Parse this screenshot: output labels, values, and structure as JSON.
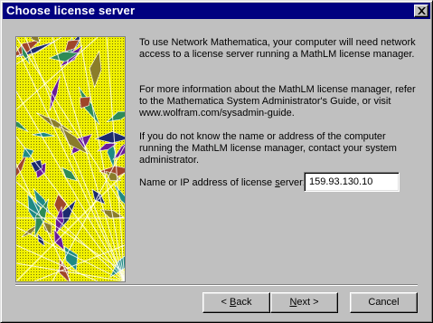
{
  "window": {
    "title": "Choose license server",
    "close_symbol": "×"
  },
  "illustration": {
    "name": "mathematica-pattern",
    "colors": {
      "background": "#f0f000",
      "green": "#2e8b57",
      "purple": "#6a1b9a",
      "olive": "#8a7d2a",
      "teal": "#1f8a84",
      "navy": "#1c2a6e",
      "rust": "#a0462a",
      "line": "#ffffff"
    }
  },
  "body": {
    "paragraph1": "To use Network Mathematica, your computer will need network access to a license server running a MathLM license manager.",
    "paragraph2": "For more information about the MathLM license manager, refer to the Mathematica System Administrator's Guide, or visit www.wolfram.com/sysadmin-guide.",
    "paragraph3": "If you do not know the name or address of the computer running the MathLM license manager, contact your system administrator."
  },
  "field": {
    "label_before": "Name or IP address of license ",
    "label_mnemonic": "s",
    "label_after": "erver:",
    "value": "159.93.130.10"
  },
  "buttons": {
    "back": {
      "before": "< ",
      "mnemonic": "B",
      "after": "ack"
    },
    "next": {
      "before": "",
      "mnemonic": "N",
      "after": "ext >"
    },
    "cancel": {
      "label": "Cancel"
    }
  }
}
